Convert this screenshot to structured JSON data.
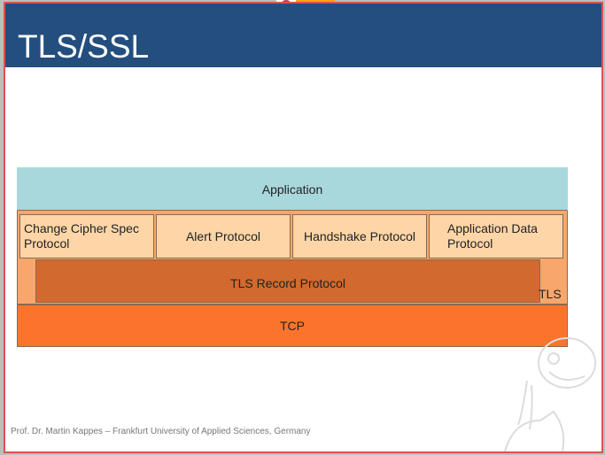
{
  "slide": {
    "title": "TLS/SSL",
    "footer": "Prof. Dr. Martin Kappes – Frankfurt University of Applied Sciences, Germany"
  },
  "diagram": {
    "application": "Application",
    "subprotocols": [
      "Change Cipher Spec Protocol",
      "Alert Protocol",
      "Handshake Protocol",
      "Application Data Protocol"
    ],
    "record": "TLS Record Protocol",
    "tls_label": "TLS",
    "tcp": "TCP"
  },
  "colors": {
    "header": "#234e7e",
    "application": "#a8d8dc",
    "tls": "#f9a66c",
    "subprotocol": "#fdd5a7",
    "record": "#d2692e",
    "tcp": "#fc742c"
  }
}
